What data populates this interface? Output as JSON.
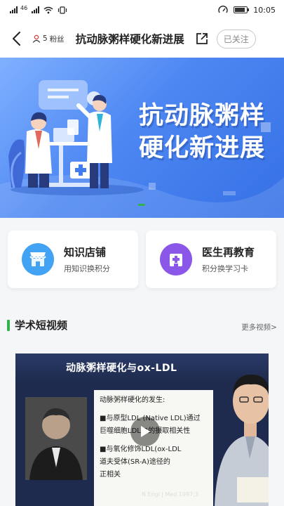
{
  "status_bar": {
    "signal_label": "46",
    "time": "10:05"
  },
  "header": {
    "fans_count": "5",
    "fans_suffix": "粉丝",
    "title": "抗动脉粥样硬化新进展",
    "follow_label": "已关注"
  },
  "banner": {
    "line1": "抗动脉粥样",
    "line2": "硬化新进展"
  },
  "cards": [
    {
      "title": "知识店铺",
      "subtitle": "用知识换积分",
      "icon": "store-icon",
      "color": "#42a3f5"
    },
    {
      "title": "医生再教育",
      "subtitle": "积分换学习卡",
      "icon": "hospital-icon",
      "color": "#8a57e8"
    }
  ],
  "section": {
    "title": "学术短视频",
    "more_label": "更多视频>"
  },
  "video": {
    "slide_title": "动脉粥样硬化与ox-LDL",
    "lines": [
      "动脉粥样硬化的发生:",
      "■与原型LDL (Native LDL)通过",
      "巨噬细胞LDL-R的摄取相关性",
      "■与氧化修饰LDL(ox-LDL",
      "道夫受体(SR-A)途径的",
      "正相关"
    ],
    "citation": "N Engl J Med 1997;3"
  },
  "colors": {
    "accent_green": "#2fb34a",
    "banner_blue": "#4d87f2"
  }
}
